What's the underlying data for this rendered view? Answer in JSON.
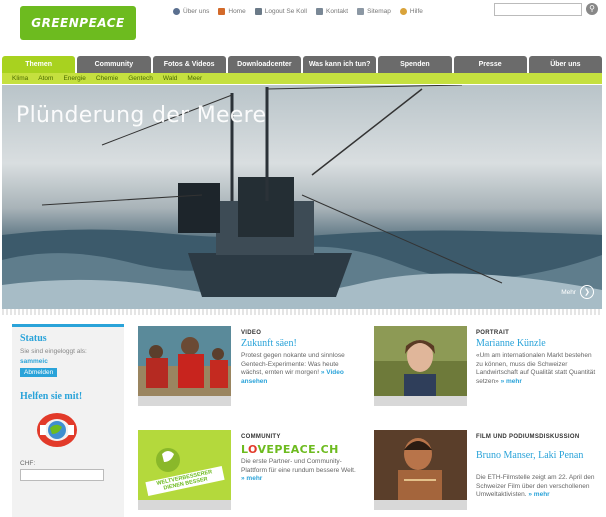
{
  "header": {
    "logo_text": "GREENPEACE",
    "toplinks": [
      {
        "label": "Über uns",
        "icon": "globe-icon"
      },
      {
        "label": "Home",
        "icon": "home-icon"
      },
      {
        "label": "Logout Se Koll",
        "icon": "logout-icon"
      },
      {
        "label": "Kontakt",
        "icon": "mail-icon"
      },
      {
        "label": "Sitemap",
        "icon": "sitemap-icon"
      },
      {
        "label": "Hilfe",
        "icon": "help-icon"
      }
    ],
    "search_placeholder": ""
  },
  "nav": {
    "tabs": [
      "Themen",
      "Community",
      "Fotos & Videos",
      "Downloadcenter",
      "Was kann ich tun?",
      "Spenden",
      "Presse",
      "Über uns"
    ],
    "active_tab": "Themen",
    "subnav": [
      "Klima",
      "Atom",
      "Energie",
      "Chemie",
      "Gentech",
      "Wald",
      "Meer"
    ]
  },
  "hero": {
    "title": "Plünderung der Meere",
    "more_label": "Mehr"
  },
  "sidebar": {
    "status_heading": "Status",
    "logged_in_text": "Sie sind eingeloggt als:",
    "username": "sammeic",
    "button_label": "Abmelden",
    "help_heading": "Helfen sie mit!",
    "chf_label": "CHF:"
  },
  "cards": [
    {
      "category": "VIDEO",
      "title": "Zukunft säen!",
      "text": "Protest gegen nokante und sinnlose Gentech-Experimente: Was heute wächst, ernten wir morgen!",
      "link": "» Video ansehen"
    },
    {
      "category": "PORTRAIT",
      "title": "Marianne Künzle",
      "text": "«Um am internationalen Markt bestehen zu können, muss die Schweizer Landwirtschaft auf Qualität statt Quantität setzen»",
      "link": "» mehr"
    },
    {
      "category": "COMMUNITY",
      "title": "LOVEPEACE.CH",
      "text": "Die erste Partner- und Community-Plattform für eine rundum bessere Welt.",
      "link": "» mehr",
      "badge_text": "WELTVERBESSERER DIENEN BESSER"
    },
    {
      "category": "FILM UND PODIUMSDISKUSSION",
      "title": "Bruno Manser, Laki Penan",
      "text": "Die ETH-Filmstelle zeigt am 22. April den Schweizer Film über den verschollenen Umweltaktivisten.",
      "link": "» mehr"
    }
  ],
  "colors": {
    "brand_green": "#6dbb1f",
    "lime": "#a8d21f",
    "link_blue": "#2aa3d9",
    "nav_gray": "#6b6b6b"
  }
}
